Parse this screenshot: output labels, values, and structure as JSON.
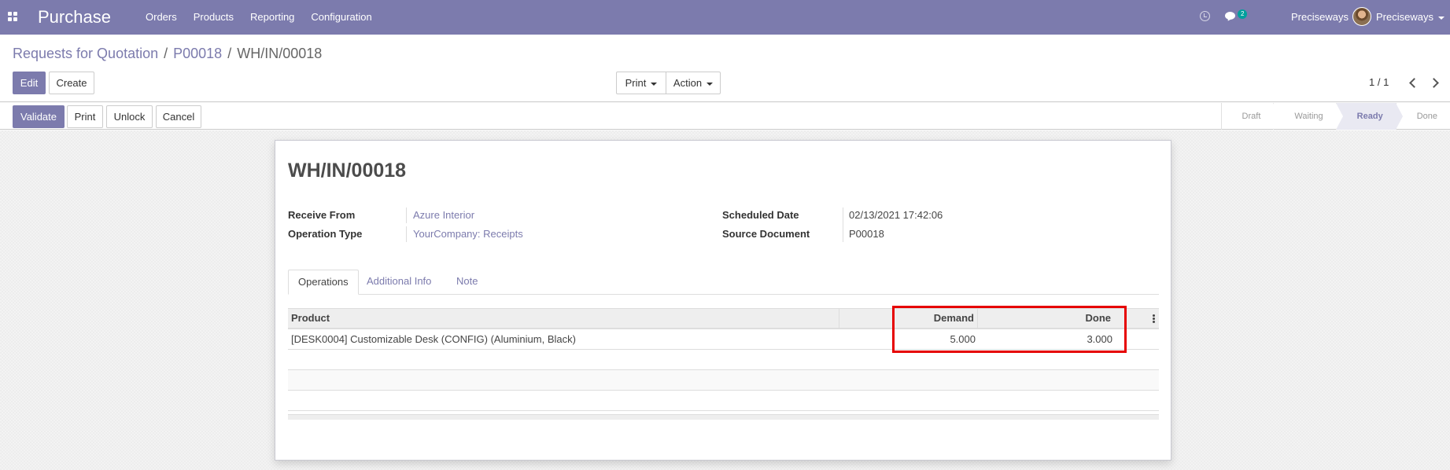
{
  "navbar": {
    "app_title": "Purchase",
    "menu": [
      "Orders",
      "Products",
      "Reporting",
      "Configuration"
    ],
    "chat_badge": "2",
    "company": "Preciseways",
    "user": "Preciseways"
  },
  "breadcrumb": {
    "items": [
      "Requests for Quotation",
      "P00018"
    ],
    "current": "WH/IN/00018",
    "separator": "/"
  },
  "control": {
    "edit_label": "Edit",
    "create_label": "Create",
    "print_label": "Print",
    "action_label": "Action",
    "pager": "1 / 1"
  },
  "statusbar": {
    "validate_label": "Validate",
    "print_label": "Print",
    "unlock_label": "Unlock",
    "cancel_label": "Cancel",
    "stages": [
      "Draft",
      "Waiting",
      "Ready",
      "Done"
    ],
    "active_stage": "Ready"
  },
  "record": {
    "title": "WH/IN/00018",
    "receive_from_label": "Receive From",
    "receive_from": "Azure Interior",
    "operation_type_label": "Operation Type",
    "operation_type": "YourCompany: Receipts",
    "scheduled_date_label": "Scheduled Date",
    "scheduled_date": "02/13/2021 17:42:06",
    "source_document_label": "Source Document",
    "source_document": "P00018"
  },
  "tabs": [
    "Operations",
    "Additional Info",
    "Note"
  ],
  "operations_table": {
    "columns": [
      "Product",
      "Demand",
      "Done"
    ],
    "rows": [
      {
        "product": "[DESK0004] Customizable Desk (CONFIG) (Aluminium, Black)",
        "demand": "5.000",
        "done": "3.000"
      }
    ]
  },
  "colors": {
    "brand": "#7c7bad",
    "highlight": "#e60000"
  }
}
